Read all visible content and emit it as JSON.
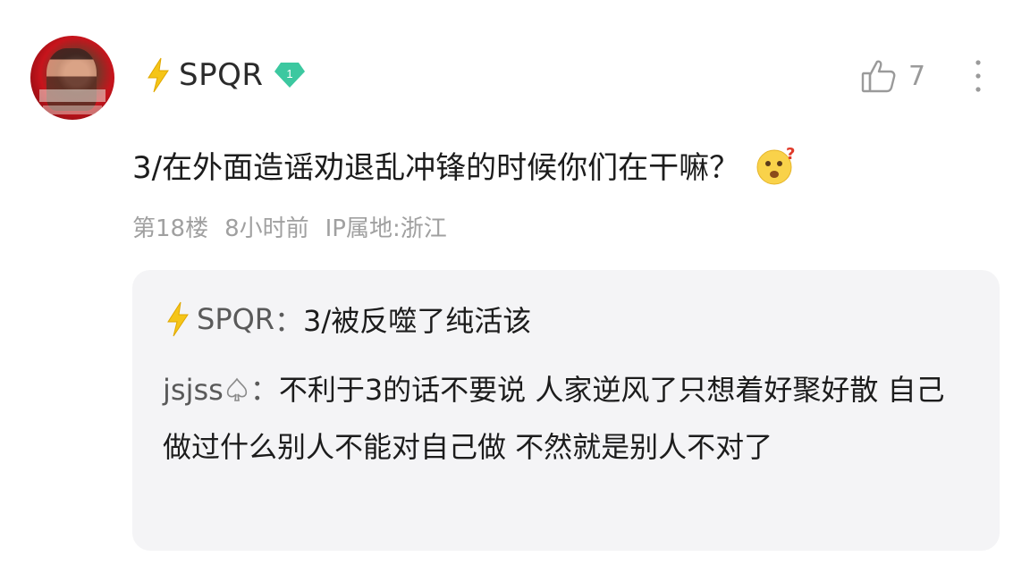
{
  "post": {
    "username": "SPQR",
    "level": "1",
    "like_count": "7",
    "comment_text": "3/在外面造谣劝退乱冲锋的时候你们在干嘛？",
    "floor": "第18楼",
    "time_ago": "8小时前",
    "ip_location": "IP属地:浙江"
  },
  "replies": [
    {
      "author": "SPQR",
      "separator": "：",
      "text": "3/被反噬了纯活该"
    },
    {
      "author": "jsjss",
      "separator": "：",
      "text": "不利于3的话不要说 人家逆风了只想着好聚好散 自己做过什么别人不能对自己做 不然就是别人不对了"
    }
  ],
  "colors": {
    "bolt": "#f5c518",
    "level_badge": "#3cc8a0",
    "meta_text": "#a0a0a0",
    "reply_bg": "#f4f4f6"
  },
  "icons": [
    "avatar",
    "bolt-icon",
    "level-badge-icon",
    "thumb-up-icon",
    "more-icon",
    "confused-emoji-icon",
    "spade-icon"
  ]
}
